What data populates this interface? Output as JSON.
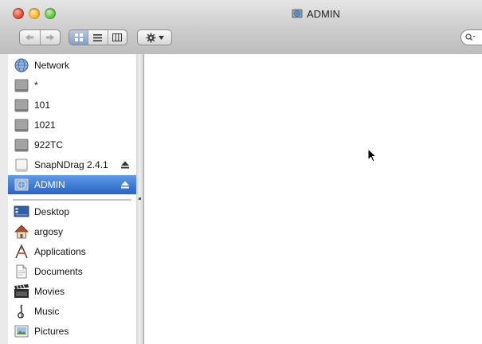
{
  "window": {
    "title": "ADMIN"
  },
  "toolbar": {
    "back_icon": "back-arrow-icon",
    "forward_icon": "forward-arrow-icon",
    "view_modes": [
      "icon-view-icon",
      "list-view-icon",
      "column-view-icon"
    ],
    "action_icon": "gear-icon",
    "search_icon": "search-icon"
  },
  "sidebar": {
    "devices": [
      {
        "label": "Network",
        "icon": "network-globe-icon"
      },
      {
        "label": "*",
        "icon": "hard-disk-icon"
      },
      {
        "label": "101",
        "icon": "hard-disk-icon"
      },
      {
        "label": "1021",
        "icon": "hard-disk-icon"
      },
      {
        "label": "922TC",
        "icon": "hard-disk-icon"
      },
      {
        "label": "SnapNDrag 2.4.1",
        "icon": "disk-image-icon",
        "eject": true
      },
      {
        "label": "ADMIN",
        "icon": "network-volume-icon",
        "eject": true,
        "selected": true
      }
    ],
    "places": [
      {
        "label": "Desktop",
        "icon": "desktop-icon"
      },
      {
        "label": "argosy",
        "icon": "home-icon"
      },
      {
        "label": "Applications",
        "icon": "applications-icon"
      },
      {
        "label": "Documents",
        "icon": "documents-icon"
      },
      {
        "label": "Movies",
        "icon": "movies-icon"
      },
      {
        "label": "Music",
        "icon": "music-icon"
      },
      {
        "label": "Pictures",
        "icon": "pictures-icon"
      }
    ]
  },
  "colors": {
    "selection": "#2763c5",
    "close": "#e0432e",
    "minimize": "#f0b429",
    "zoom": "#5cbf3c"
  }
}
